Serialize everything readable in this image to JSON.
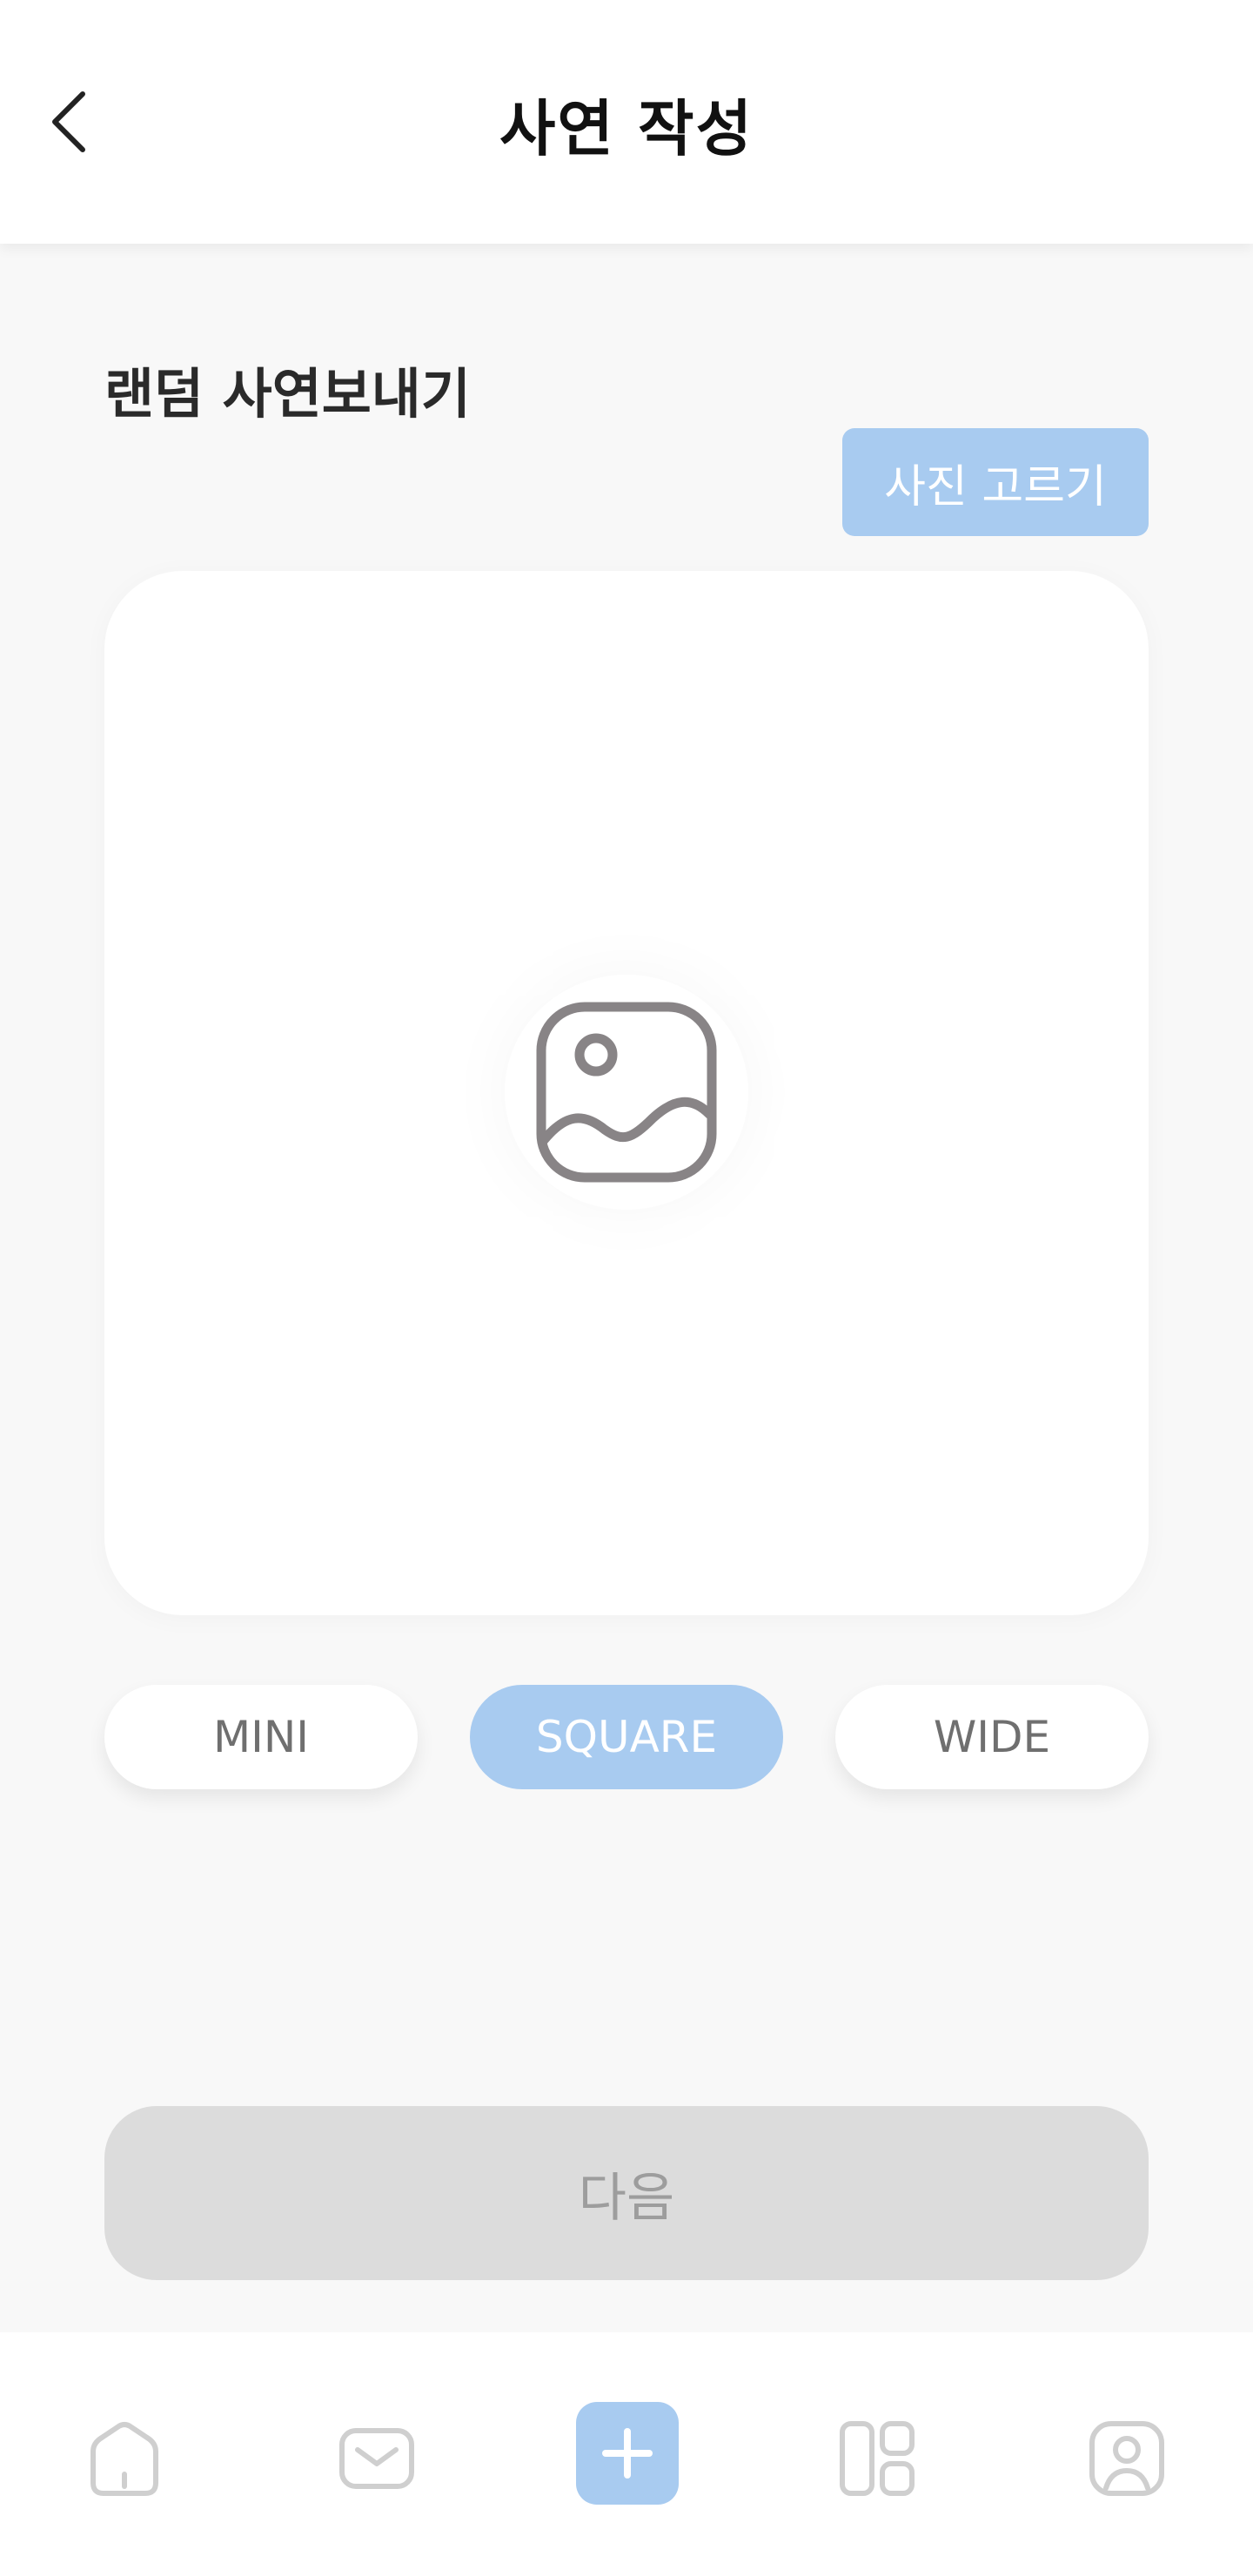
{
  "header": {
    "title": "사연 작성",
    "back_icon": "chevron-left-icon"
  },
  "section": {
    "title": "랜덤 사연보내기"
  },
  "pick_photo": {
    "label": "사진 고르기"
  },
  "preview": {
    "icon": "image-placeholder-icon"
  },
  "sizes": [
    {
      "label": "MINI",
      "selected": false
    },
    {
      "label": "SQUARE",
      "selected": true
    },
    {
      "label": "WIDE",
      "selected": false
    }
  ],
  "next_button": {
    "label": "다음",
    "enabled": false
  },
  "bottom_nav": {
    "items": [
      {
        "icon": "home-icon"
      },
      {
        "icon": "mail-icon"
      },
      {
        "icon": "plus-icon"
      },
      {
        "icon": "grid-icon"
      },
      {
        "icon": "profile-icon"
      }
    ]
  },
  "colors": {
    "accent": "#a8cbf0",
    "background": "#f8f8f8",
    "disabled": "#dcdcdc"
  }
}
